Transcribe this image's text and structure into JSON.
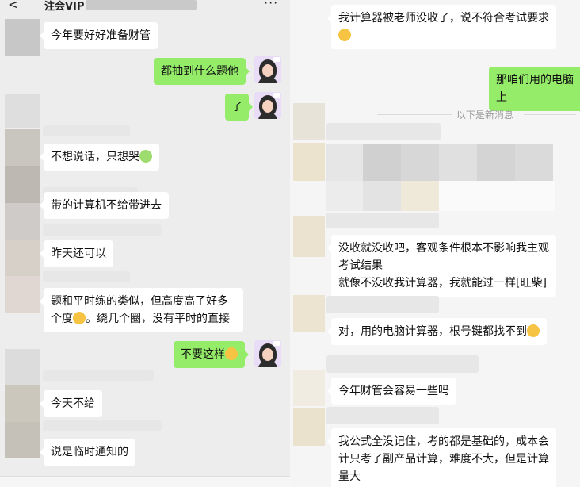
{
  "left": {
    "header": {
      "back": "<",
      "title": "注会VIP",
      "more": "···"
    },
    "messages": [
      {
        "id": "m1",
        "side": "in",
        "text": "今年要好好准备财管"
      },
      {
        "id": "m2",
        "side": "out",
        "text": "都抽到什么题他"
      },
      {
        "id": "m3",
        "side": "out",
        "text": "了"
      },
      {
        "id": "m4",
        "side": "in",
        "text": "不想说话，只想哭"
      },
      {
        "id": "m5",
        "side": "in",
        "text": "带的计算机不给带进去"
      },
      {
        "id": "m6",
        "side": "in",
        "text": "昨天还可以"
      },
      {
        "id": "m7",
        "side": "in",
        "text": "题和平时练的类似，但高度高了好多\n个度"
      },
      {
        "id": "m7b",
        "side": "in",
        "text": "。绕几个圈，没有平时的直接"
      },
      {
        "id": "m8",
        "side": "out",
        "text": "不要这样"
      },
      {
        "id": "m9",
        "side": "in",
        "text": "今天不给"
      },
      {
        "id": "m10",
        "side": "in",
        "text": "说是临时通知的"
      }
    ]
  },
  "right": {
    "messages": [
      {
        "id": "r1",
        "side": "in",
        "text": "我计算器被老师没收了，说不符合考试要求"
      },
      {
        "id": "r2",
        "side": "out",
        "text": "那咱们用的电脑上"
      },
      {
        "id": "r3",
        "side": "in",
        "text": "没收就没收吧，客观条件根本不影响我主观\n考试结果\n就像不没收我计算器，我就能过一样[旺柴]"
      },
      {
        "id": "r4",
        "side": "in",
        "text": "对，用的电脑计算器，根号键都找不到"
      },
      {
        "id": "r5",
        "side": "in",
        "text": "今年财管会容易一些吗"
      },
      {
        "id": "r6",
        "side": "in",
        "text": "我公式全没记住，考的都是基础的，成本会\n计只考了副产品计算，难度不大，但是计算\n量大"
      }
    ],
    "divider": "以下是新消息"
  },
  "colors": {
    "out_bubble": "#95ec69",
    "in_bubble": "#ffffff",
    "bg": "#ededed"
  }
}
